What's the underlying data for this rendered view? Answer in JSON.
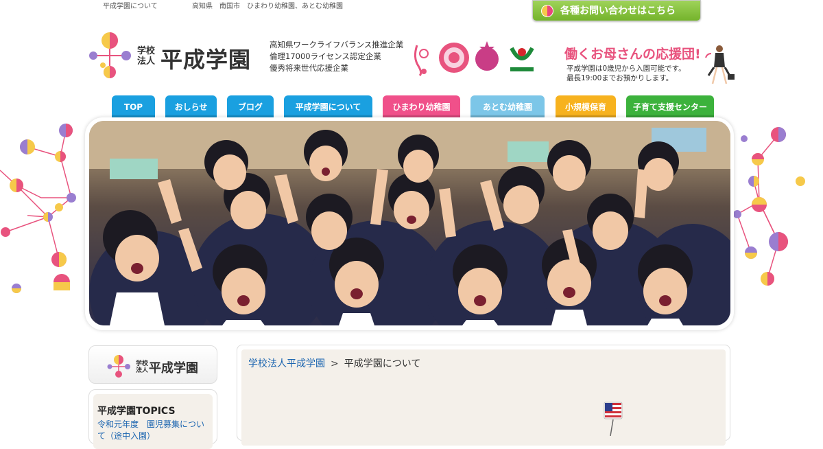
{
  "topbar": {
    "about_link": "平成学園について",
    "location_text": "高知県　南国市　ひまわり幼稚園、あとむ幼稚園"
  },
  "contact_button": {
    "label": "各種お問い合わせはこちら"
  },
  "header": {
    "logo_small_line1": "学校",
    "logo_small_line2": "法人",
    "logo_name": "平成学園",
    "certifications": [
      "高知県ワークライフバランス推進企業",
      "倫理17000ライセンス認定企業",
      "優秀将来世代応援企業"
    ],
    "mom_title": "働くお母さんの応援団!",
    "mom_lines": [
      "平成学園は0歳児から入園可能です。",
      "最長19:00までお預かりします。"
    ]
  },
  "nav": {
    "tabs": [
      {
        "label": "TOP",
        "color": "#1aa0e0"
      },
      {
        "label": "おしらせ",
        "color": "#1aa0e0"
      },
      {
        "label": "ブログ",
        "color": "#1aa0e0"
      },
      {
        "label": "平成学園について",
        "color": "#1aa0e0"
      },
      {
        "label": "ひまわり幼稚園",
        "color": "#f0508a"
      },
      {
        "label": "あとむ幼稚園",
        "color": "#7cc6e8"
      },
      {
        "label": "小規模保育",
        "color": "#f7b21e"
      },
      {
        "label": "子育て支援センター",
        "color": "#3cb23c"
      }
    ]
  },
  "sidebar": {
    "logo_small_line1": "学校",
    "logo_small_line2": "法人",
    "logo_name": "平成学園",
    "topics_title": "平成学園TOPICS",
    "topics_link": "令和元年度　園児募集について（途中入園）"
  },
  "breadcrumb": {
    "home": "学校法人平成学園",
    "separator": ">",
    "current": "平成学園について"
  },
  "colors": {
    "pink": "#e8537e",
    "yellow": "#f6c94a",
    "purple": "#9a7ed0",
    "link": "#1a64b0"
  }
}
